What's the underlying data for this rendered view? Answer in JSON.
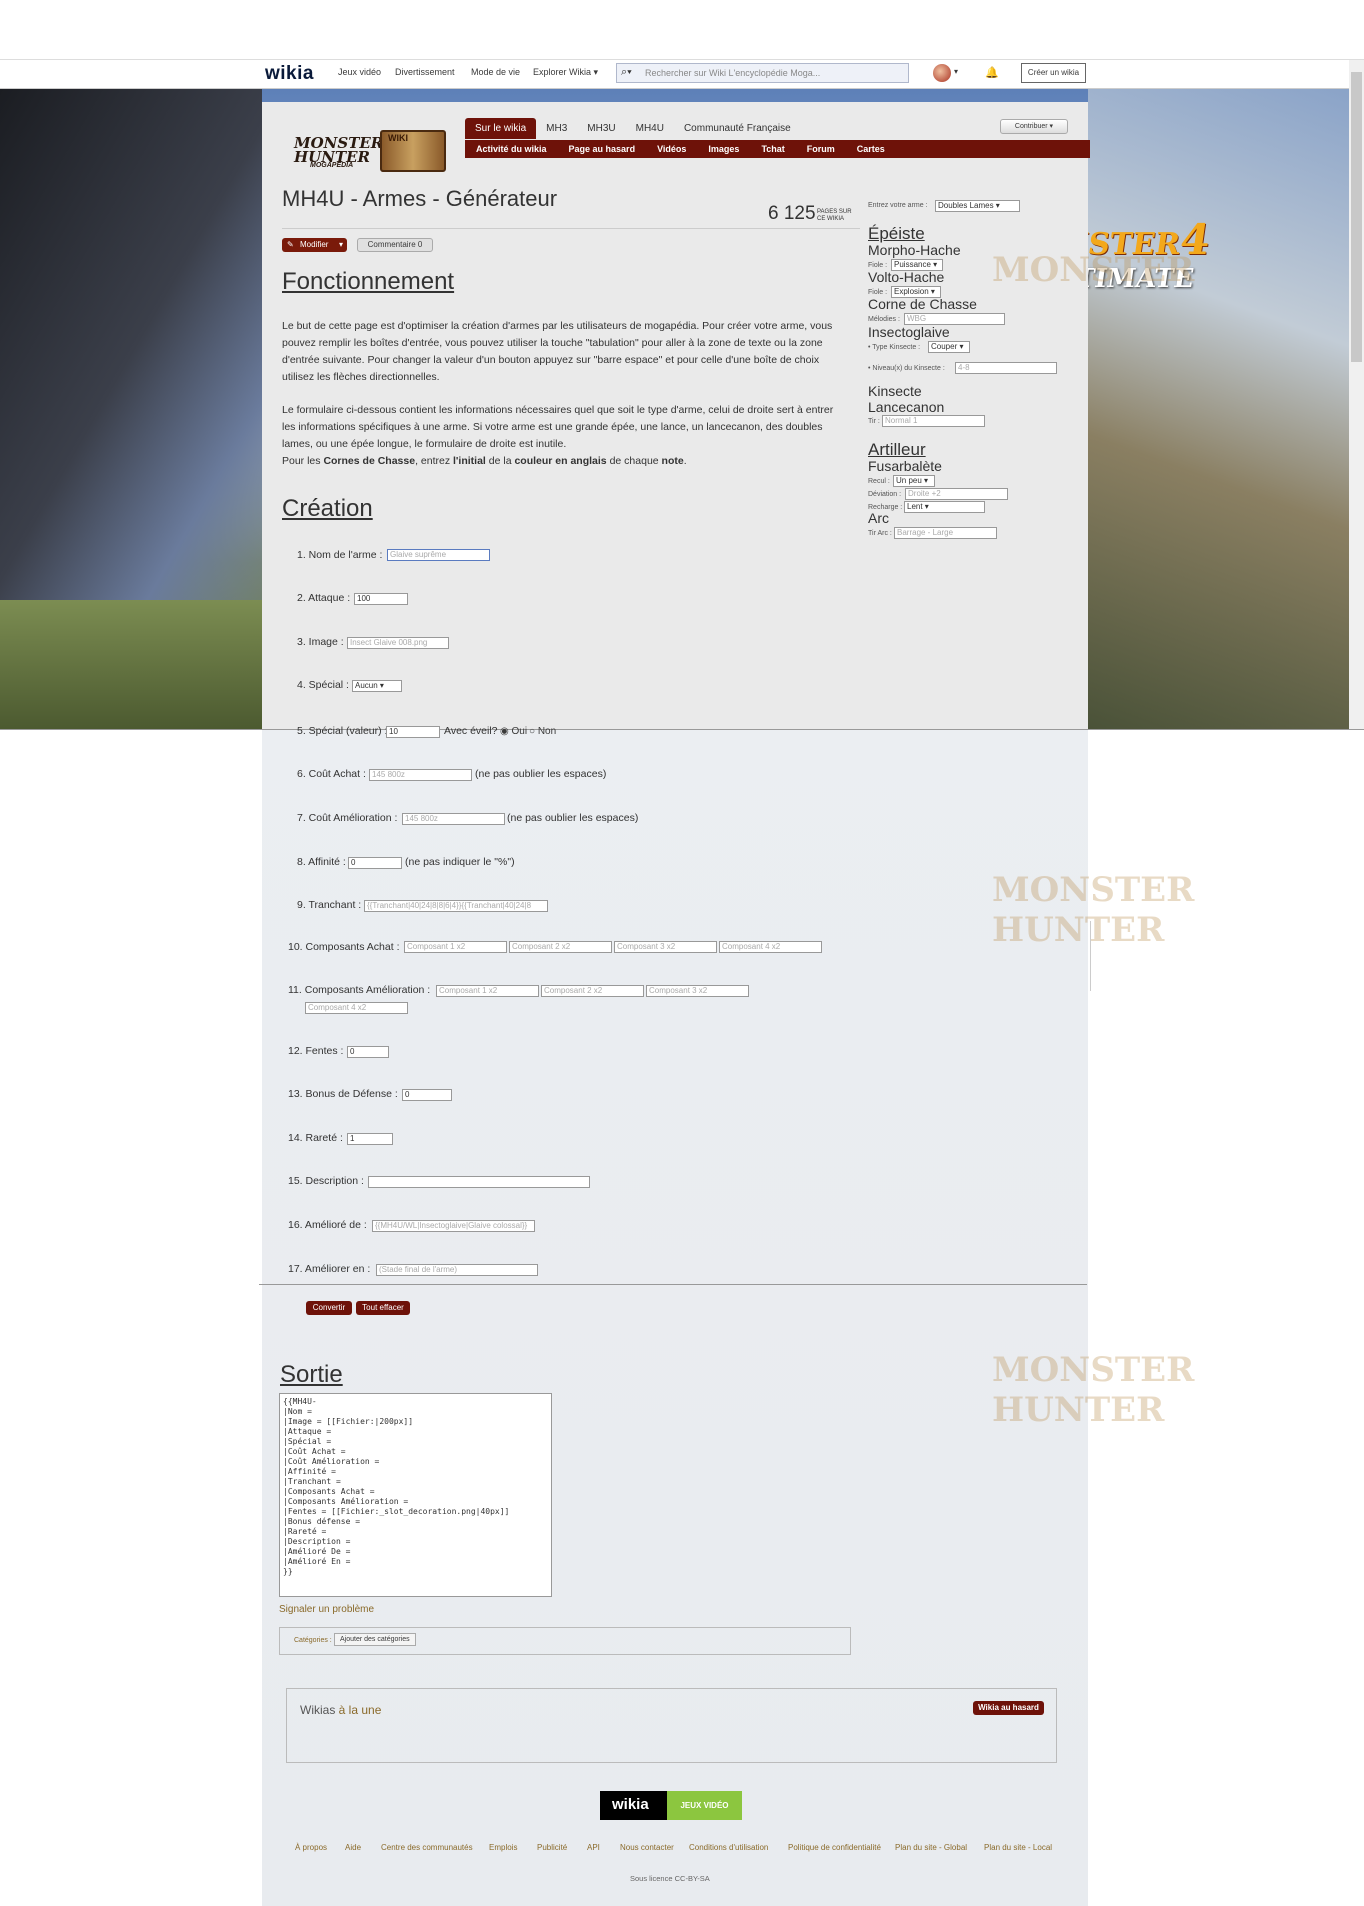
{
  "topbar": {
    "logo": "wikia",
    "nav": [
      "Jeux vidéo",
      "Divertissement",
      "Mode de vie",
      "Explorer Wikia ▾"
    ],
    "search_placeholder": "Rechercher sur Wiki L'encyclopédie Moga...",
    "create": "Créer un wikia"
  },
  "header": {
    "logo_line1": "MONSTER",
    "logo_line2": "HUNTER",
    "logo_wiki": "WIKI",
    "logo_sub": "MOGAPEDIA",
    "contribute": "Contribuer ▾",
    "tabs": [
      "Sur le wikia",
      "MH3",
      "MH3U",
      "MH4U",
      "Communauté Française"
    ],
    "subnav": [
      "Activité du wikia",
      "Page au hasard",
      "Vidéos",
      "Images",
      "Tchat",
      "Forum",
      "Cartes"
    ]
  },
  "page": {
    "title": "MH4U - Armes - Générateur",
    "count": "6 125",
    "count_label": "PAGES SUR CE WIKIA",
    "modify": "Modifier",
    "comment": "Commentaire",
    "comment_count": "0"
  },
  "fonctionnement": {
    "heading": "Fonctionnement",
    "p1": "Le but de cette page est d'optimiser la création d'armes par les utilisateurs de mogapédia. Pour créer votre arme, vous pouvez remplir les boîtes d'entrée, vous pouvez utiliser la touche \"tabulation\" pour aller à la zone de texte ou la zone d'entrée suivante. Pour changer la valeur d'un bouton appuyez sur \"barre espace\" et pour celle d'une boîte de choix utilisez les flèches directionnelles.",
    "p2": "Le formulaire ci-dessous contient les informations nécessaires quel que soit le type d'arme, celui de droite sert à entrer les informations spécifiques à une arme. Si votre arme est une grande épée, une lance, un lancecanon, des doubles lames, ou une épée longue, le formulaire de droite est inutile.",
    "p3a": "Pour les ",
    "p3b": "Cornes de Chasse",
    "p3c": ", entrez ",
    "p3d": "l'initial",
    "p3e": " de la ",
    "p3f": "couleur en anglais",
    "p3g": " de chaque ",
    "p3h": "note",
    "p3i": "."
  },
  "creation": {
    "heading": "Création",
    "f1": "1. Nom de l'arme :",
    "f1ph": "Glaive suprême",
    "f2": "2. Attaque :",
    "f2v": "100",
    "f3": "3. Image :",
    "f3ph": "Insect Glaive 008.png",
    "f4": "4. Spécial :",
    "f4v": "Aucun ▾",
    "f5": "5. Spécial (valeur) :",
    "f5v": "10",
    "f5b": "Avec éveil?",
    "f5oui": "Oui",
    "f5non": "Non",
    "f6": "6. Coût Achat :",
    "f6ph": "145 800z",
    "f6n": "(ne pas oublier les espaces)",
    "f7": "7. Coût Amélioration :",
    "f7ph": "145 800z",
    "f7n": "(ne pas oublier les espaces)",
    "f8": "8. Affinité :",
    "f8v": "0",
    "f8n": "(ne pas indiquer le \"%\")",
    "f9": "9. Tranchant :",
    "f9ph": "{{Tranchant|40|24|8|8|6|4}}{{Tranchant|40|24|8",
    "f10": "10. Composants Achat :",
    "f10ph": [
      "Composant 1 x2",
      "Composant 2 x2",
      "Composant 3 x2",
      "Composant 4 x2"
    ],
    "f11": "11. Composants Amélioration :",
    "f11ph": [
      "Composant 1 x2",
      "Composant 2 x2",
      "Composant 3 x2",
      "Composant 4 x2"
    ],
    "f12": "12. Fentes :",
    "f12v": "0",
    "f13": "13. Bonus de Défense :",
    "f13v": "0",
    "f14": "14. Rareté :",
    "f14v": "1",
    "f15": "15. Description :",
    "f16": "16. Amélioré de :",
    "f16ph": "{{MH4U/WL|Insectoglaive|Glaive colossal}}",
    "f17": "17. Améliorer en :",
    "f17ph": "(Stade final de l'arme)",
    "convert": "Convertir",
    "clear": "Tout effacer"
  },
  "side": {
    "label": "Entrez votre arme :",
    "weapon": "Doubles Lames ▾",
    "epeiste": "Épéiste",
    "morpho": "Morpho-Hache",
    "fiole": "Fiole :",
    "fiole1": "Puissance ▾",
    "volto": "Volto-Hache",
    "fiole2": "Explosion ▾",
    "corne": "Corne de Chasse",
    "melodies": "Mélodies :",
    "melph": "WBG",
    "insecto": "Insectoglaive",
    "typek": "• Type Kinsecte :",
    "typekv": "Couper ▾",
    "niveau": "• Niveau(x) du Kinsecte :",
    "niveauph": "4-8",
    "kinsecte": "Kinsecte",
    "lancecanon": "Lancecanon",
    "tir": "Tir :",
    "tirph": "Normal 1",
    "artilleur": "Artilleur",
    "fusar": "Fusarbalète",
    "recul": "Recul :",
    "reculv": "Un peu ▾",
    "deviation": "Déviation :",
    "devph": "Droite +2",
    "recharge": "Recharge :",
    "rechv": "Lent ▾",
    "arc": "Arc",
    "tirarc": "Tir Arc :",
    "tirarcph": "Barrage - Large"
  },
  "sortie": {
    "heading": "Sortie",
    "text": "{{MH4U-\n|Nom = \n|Image = [[Fichier:|200px]]\n|Attaque = \n|Spécial = \n|Coût Achat = \n|Coût Amélioration = \n|Affinité = \n|Tranchant = \n|Composants Achat = \n|Composants Amélioration = \n|Fentes = [[Fichier:_slot_decoration.png|40px]]\n|Bonus défense = \n|Rareté = \n|Description = \n|Amélioré De = \n|Amélioré En = \n}}"
  },
  "footer": {
    "report": "Signaler un problème",
    "cat_label": "Catégories :",
    "cat_add": "Ajouter des catégories",
    "una_a": "Wikias ",
    "una_b": "à la une",
    "random": "Wikia au hasard",
    "logo": "wikia",
    "logo_g": "JEUX VIDÉO",
    "links": [
      "À propos",
      "Aide",
      "Centre des communautés",
      "Emplois",
      "Publicité",
      "API",
      "Nous contacter",
      "Conditions d'utilisation",
      "Politique de confidentialité",
      "Plan du site - Global",
      "Plan du site - Local"
    ],
    "license": "Sous licence CC-BY-SA"
  },
  "watermark": {
    "l1": "MONSTER",
    "l2": "HUNTER",
    "l3": "ULTIMATE"
  },
  "colors": {
    "accent": "#6e1209",
    "gold": "#f3a81b"
  }
}
